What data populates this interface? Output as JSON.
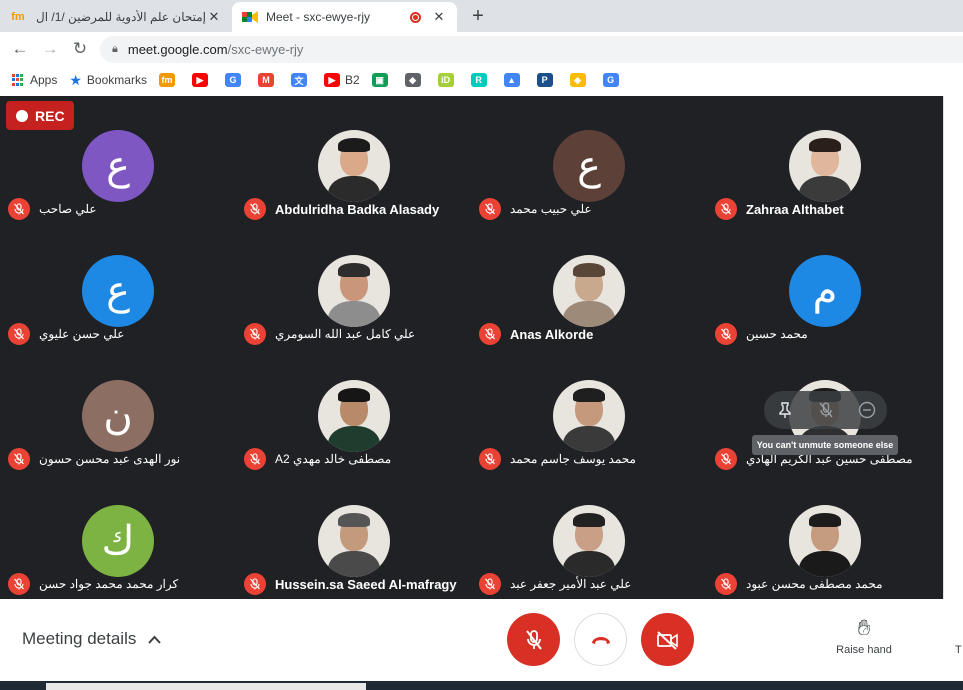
{
  "browser": {
    "tabs": [
      {
        "title": "إمتحان علم الأدوية للمرضين /1/ ال",
        "favicon": "fm",
        "active": false
      },
      {
        "title": "Meet - sxc-ewye-rjy",
        "favicon": "meet",
        "active": true
      }
    ],
    "close_glyph": "✕",
    "newtab_glyph": "+",
    "url_host": "meet.google.com",
    "url_path": "/sxc-ewye-rjy",
    "bookmarks": [
      {
        "label": "Apps",
        "icon": "apps-grid-icon"
      },
      {
        "label": "Bookmarks",
        "icon": "star-icon"
      },
      {
        "label": "",
        "icon": "fm-icon",
        "glyph": "fm",
        "color": "#f29900"
      },
      {
        "label": "",
        "icon": "youtube-icon",
        "glyph": "▶",
        "color": "#ff0000"
      },
      {
        "label": "",
        "icon": "google-icon",
        "glyph": "G",
        "color": "#4285f4"
      },
      {
        "label": "",
        "icon": "gmail-icon",
        "glyph": "M",
        "color": "#ea4335"
      },
      {
        "label": "",
        "icon": "translate-icon",
        "glyph": "文",
        "color": "#4285f4"
      },
      {
        "label": "B2",
        "icon": "youtube-icon",
        "glyph": "▶",
        "color": "#ff0000"
      },
      {
        "label": "",
        "icon": "classroom-icon",
        "glyph": "▣",
        "color": "#0f9d58"
      },
      {
        "label": "",
        "icon": "cube-icon",
        "glyph": "◆",
        "color": "#5f6368"
      },
      {
        "label": "",
        "icon": "orcid-icon",
        "glyph": "iD",
        "color": "#a6ce39"
      },
      {
        "label": "",
        "icon": "researchgate-icon",
        "glyph": "R",
        "color": "#00ccbb"
      },
      {
        "label": "",
        "icon": "scholar-icon",
        "glyph": "▲",
        "color": "#4285f4"
      },
      {
        "label": "",
        "icon": "p-icon",
        "glyph": "P",
        "color": "#1a4f8a"
      },
      {
        "label": "",
        "icon": "shield-icon",
        "glyph": "◈",
        "color": "#fbbc04"
      },
      {
        "label": "",
        "icon": "google-icon",
        "glyph": "G",
        "color": "#4285f4"
      }
    ]
  },
  "meet": {
    "rec_label": "REC",
    "participants": [
      {
        "name": "علي صاحب",
        "avatar": "letter",
        "letter": "ع",
        "color": "#7e57c2"
      },
      {
        "name": "Abdulridha Badka Alasady",
        "avatar": "photo",
        "skin": "#d9a98a",
        "shirt": "#2b2b2b",
        "hair": "#1b1b1b"
      },
      {
        "name": "علي حبيب محمد",
        "avatar": "letter",
        "letter": "ع",
        "color": "#5d4037"
      },
      {
        "name": "Zahraa Althabet",
        "avatar": "photo",
        "skin": "#e0b79c",
        "shirt": "#3b3b3b",
        "hair": "#2a1f1a"
      },
      {
        "name": "علي حسن عليوي",
        "avatar": "letter",
        "letter": "ع",
        "color": "#1e88e5"
      },
      {
        "name": "علي كامل عبد الله السومري",
        "avatar": "photo",
        "skin": "#c9967a",
        "shirt": "#8d8d8d",
        "hair": "#2d2d2d"
      },
      {
        "name": "Anas Alkorde",
        "avatar": "photo",
        "skin": "#c8a98e",
        "shirt": "#9e8a78",
        "hair": "#5a4636"
      },
      {
        "name": "محمد حسين",
        "avatar": "letter",
        "letter": "م",
        "color": "#1e88e5"
      },
      {
        "name": "نور الهدى عبد محسن حسون",
        "avatar": "letter",
        "letter": "ن",
        "color": "#8d6e63"
      },
      {
        "name": "مصطفى خالد مهدي A2",
        "avatar": "photo",
        "skin": "#b98a6a",
        "shirt": "#1f3d2e",
        "hair": "#161616"
      },
      {
        "name": "محمد يوسف جاسم محمد",
        "avatar": "photo",
        "skin": "#c59a7c",
        "shirt": "#3a3a3a",
        "hair": "#1f1f1f"
      },
      {
        "name": "مصطفى حسين عبد الكريم الهادي",
        "avatar": "photo",
        "skin": "#d0a587",
        "shirt": "#2f2f2f",
        "hair": "#1a1a1a"
      },
      {
        "name": "كرار محمد محمد جواد حسن",
        "avatar": "letter",
        "letter": "ك",
        "color": "#7cb342"
      },
      {
        "name": "Hussein.sa Saeed Al-mafragy",
        "avatar": "photo",
        "skin": "#c49a7d",
        "shirt": "#4a4a4a",
        "hair": "#555555"
      },
      {
        "name": "علي عبد الأمير جعفر عبد",
        "avatar": "photo",
        "skin": "#c9a086",
        "shirt": "#2a2a2a",
        "hair": "#222222"
      },
      {
        "name": "محمد مصطفى محسن عبود",
        "avatar": "photo",
        "skin": "#c69c80",
        "shirt": "#1a1a1a",
        "hair": "#1c1c1c"
      }
    ],
    "hover_controls": [
      "pin-icon",
      "mic-off-icon",
      "remove-icon"
    ],
    "tooltip": "You can't unmute someone else",
    "meeting_details": "Meeting details",
    "raise_hand": "Raise hand",
    "edge_label": "T"
  }
}
